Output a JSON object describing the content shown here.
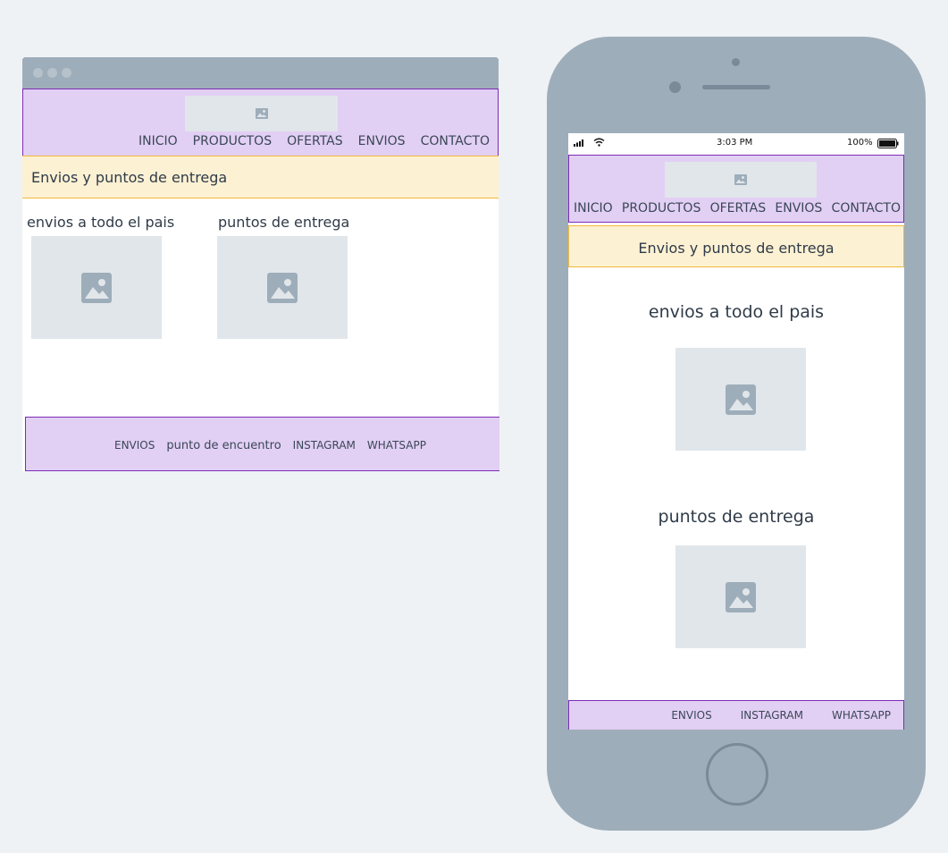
{
  "desktop": {
    "nav": [
      "INICIO",
      "PRODUCTOS",
      "OFERTAS",
      "ENVIOS",
      "CONTACTO"
    ],
    "banner": "Envios y puntos de entrega",
    "sections": [
      "envios a todo el pais",
      "puntos de entrega"
    ],
    "footer": [
      "ENVIOS",
      "punto de encuentro",
      "INSTAGRAM",
      "WHATSAPP"
    ]
  },
  "mobile": {
    "status": {
      "time": "3:03 PM",
      "battery": "100%"
    },
    "nav": [
      "INICIO",
      "PRODUCTOS",
      "OFERTAS",
      "ENVIOS",
      "CONTACTO"
    ],
    "banner": "Envios y puntos de entrega",
    "sections": [
      "envios a todo el pais",
      "puntos de entrega"
    ],
    "footer": [
      "ENVIOS",
      "INSTAGRAM",
      "WHATSAPP"
    ]
  },
  "colors": {
    "header_bg": "#e2cff4",
    "header_border": "#7d2cb5",
    "banner_bg": "#fdf1d3",
    "banner_border": "#f3b93a",
    "device_frame": "#9eadba",
    "placeholder_bg": "#e1e6ea",
    "page_bg": "#eff2f5"
  },
  "icons": [
    "image-placeholder-icon",
    "signal-icon",
    "wifi-icon",
    "battery-icon"
  ]
}
